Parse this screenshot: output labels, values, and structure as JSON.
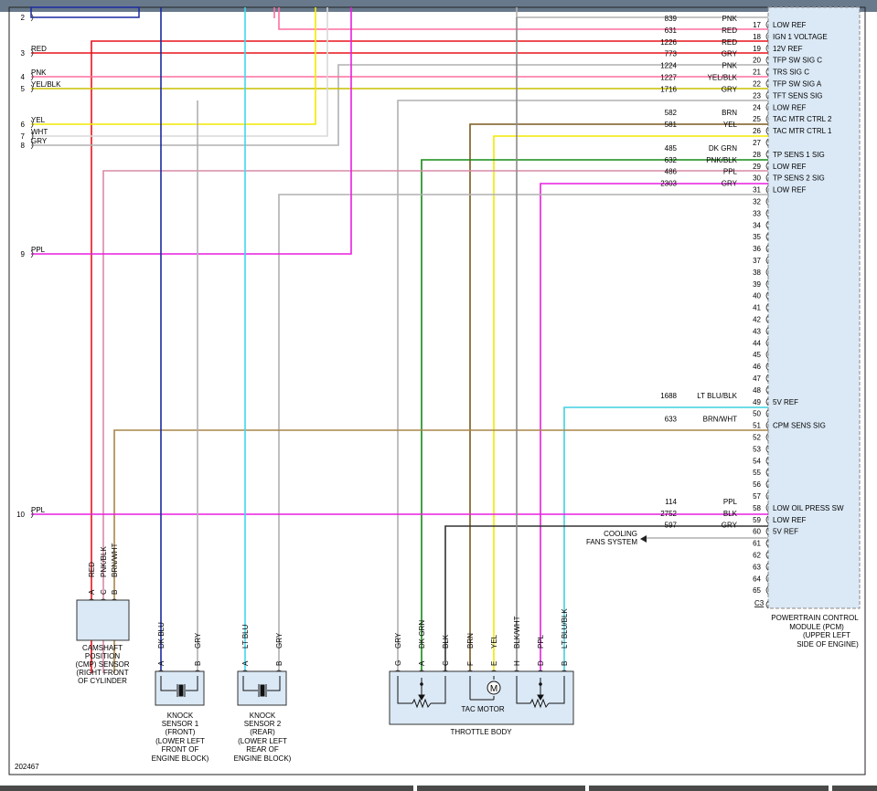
{
  "left_connector": [
    {
      "pin": "2",
      "color": ""
    },
    {
      "pin": "3",
      "color": "RED"
    },
    {
      "pin": "4",
      "color": "PNK"
    },
    {
      "pin": "5",
      "color": "YEL/BLK"
    },
    {
      "pin": "6",
      "color": "YEL"
    },
    {
      "pin": "7",
      "color": "WHT"
    },
    {
      "pin": "8",
      "color": "GRY"
    },
    {
      "pin": "9",
      "color": "PPL"
    },
    {
      "pin": "10",
      "color": "PPL"
    }
  ],
  "pcm_pins": [
    {
      "pin": "17",
      "circuit": "839",
      "color": "PNK",
      "func": "LOW REF"
    },
    {
      "pin": "18",
      "circuit": "631",
      "color": "RED",
      "func": "IGN 1 VOLTAGE"
    },
    {
      "pin": "19",
      "circuit": "1226",
      "color": "RED",
      "func": "12V REF"
    },
    {
      "pin": "20",
      "circuit": "773",
      "color": "GRY",
      "func": "TFP SW SIG C"
    },
    {
      "pin": "21",
      "circuit": "1224",
      "color": "PNK",
      "func": "TRS SIG C"
    },
    {
      "pin": "22",
      "circuit": "1227",
      "color": "YEL/BLK",
      "func": "TFP SW SIG A"
    },
    {
      "pin": "23",
      "circuit": "1716",
      "color": "GRY",
      "func": "TFT SENS SIG"
    },
    {
      "pin": "24",
      "circuit": "",
      "color": "",
      "func": "LOW REF"
    },
    {
      "pin": "25",
      "circuit": "582",
      "color": "BRN",
      "func": "TAC MTR CTRL 2"
    },
    {
      "pin": "26",
      "circuit": "581",
      "color": "YEL",
      "func": "TAC MTR CTRL 1"
    },
    {
      "pin": "27",
      "circuit": "",
      "color": "",
      "func": ""
    },
    {
      "pin": "28",
      "circuit": "485",
      "color": "DK GRN",
      "func": "TP SENS 1 SIG"
    },
    {
      "pin": "29",
      "circuit": "632",
      "color": "PNK/BLK",
      "func": "LOW REF"
    },
    {
      "pin": "30",
      "circuit": "486",
      "color": "PPL",
      "func": "TP SENS 2 SIG"
    },
    {
      "pin": "31",
      "circuit": "2303",
      "color": "GRY",
      "func": "LOW REF"
    },
    {
      "pin": "32",
      "circuit": "",
      "color": "",
      "func": ""
    },
    {
      "pin": "33",
      "circuit": "",
      "color": "",
      "func": ""
    },
    {
      "pin": "34",
      "circuit": "",
      "color": "",
      "func": ""
    },
    {
      "pin": "35",
      "circuit": "",
      "color": "",
      "func": ""
    },
    {
      "pin": "36",
      "circuit": "",
      "color": "",
      "func": ""
    },
    {
      "pin": "37",
      "circuit": "",
      "color": "",
      "func": ""
    },
    {
      "pin": "38",
      "circuit": "",
      "color": "",
      "func": ""
    },
    {
      "pin": "39",
      "circuit": "",
      "color": "",
      "func": ""
    },
    {
      "pin": "40",
      "circuit": "",
      "color": "",
      "func": ""
    },
    {
      "pin": "41",
      "circuit": "",
      "color": "",
      "func": ""
    },
    {
      "pin": "42",
      "circuit": "",
      "color": "",
      "func": ""
    },
    {
      "pin": "43",
      "circuit": "",
      "color": "",
      "func": ""
    },
    {
      "pin": "44",
      "circuit": "",
      "color": "",
      "func": ""
    },
    {
      "pin": "45",
      "circuit": "",
      "color": "",
      "func": ""
    },
    {
      "pin": "46",
      "circuit": "",
      "color": "",
      "func": ""
    },
    {
      "pin": "47",
      "circuit": "",
      "color": "",
      "func": ""
    },
    {
      "pin": "48",
      "circuit": "",
      "color": "",
      "func": ""
    },
    {
      "pin": "49",
      "circuit": "1688",
      "color": "LT BLU/BLK",
      "func": "5V REF"
    },
    {
      "pin": "50",
      "circuit": "",
      "color": "",
      "func": ""
    },
    {
      "pin": "51",
      "circuit": "633",
      "color": "BRN/WHT",
      "func": "CPM SENS SIG"
    },
    {
      "pin": "52",
      "circuit": "",
      "color": "",
      "func": ""
    },
    {
      "pin": "53",
      "circuit": "",
      "color": "",
      "func": ""
    },
    {
      "pin": "54",
      "circuit": "",
      "color": "",
      "func": ""
    },
    {
      "pin": "55",
      "circuit": "",
      "color": "",
      "func": ""
    },
    {
      "pin": "56",
      "circuit": "",
      "color": "",
      "func": ""
    },
    {
      "pin": "57",
      "circuit": "",
      "color": "",
      "func": ""
    },
    {
      "pin": "58",
      "circuit": "114",
      "color": "PPL",
      "func": "LOW OIL PRESS SW"
    },
    {
      "pin": "59",
      "circuit": "2752",
      "color": "BLK",
      "func": "LOW REF"
    },
    {
      "pin": "60",
      "circuit": "597",
      "color": "GRY",
      "func": "5V REF"
    },
    {
      "pin": "61",
      "circuit": "",
      "color": "",
      "func": ""
    },
    {
      "pin": "62",
      "circuit": "",
      "color": "",
      "func": ""
    },
    {
      "pin": "63",
      "circuit": "",
      "color": "",
      "func": ""
    },
    {
      "pin": "64",
      "circuit": "",
      "color": "",
      "func": ""
    },
    {
      "pin": "65",
      "circuit": "",
      "color": "",
      "func": ""
    }
  ],
  "connector_id": "C3",
  "pcm_label": [
    "POWERTRAIN CONTROL",
    "MODULE (PCM)",
    "(UPPER LEFT",
    "SIDE OF ENGINE)"
  ],
  "cooling_label": [
    "COOLING",
    "FANS SYSTEM"
  ],
  "cmp": {
    "wires": [
      {
        "pin": "A",
        "color": "RED"
      },
      {
        "pin": "C",
        "color": "PNK/BLK"
      },
      {
        "pin": "B",
        "color": "BRN/WHT"
      }
    ],
    "label": [
      "CAMSHAFT",
      "POSITION",
      "(CMP) SENSOR",
      "(RIGHT FRONT",
      "OF CYLINDER"
    ]
  },
  "ks1": {
    "wires": [
      {
        "pin": "A",
        "color": "DK BLU"
      },
      {
        "pin": "B",
        "color": "GRY"
      }
    ],
    "label": [
      "KNOCK",
      "SENSOR 1",
      "(FRONT)",
      "(LOWER LEFT",
      "FRONT OF",
      "ENGINE BLOCK)"
    ]
  },
  "ks2": {
    "wires": [
      {
        "pin": "A",
        "color": "LT BLU"
      },
      {
        "pin": "B",
        "color": "GRY"
      }
    ],
    "label": [
      "KNOCK",
      "SENSOR 2",
      "(REAR)",
      "(LOWER LEFT",
      "REAR OF",
      "ENGINE BLOCK)"
    ]
  },
  "throttle": {
    "wires": [
      {
        "pin": "G",
        "color": "GRY"
      },
      {
        "pin": "A",
        "color": "DK GRN"
      },
      {
        "pin": "C",
        "color": "BLK"
      },
      {
        "pin": "F",
        "color": "BRN"
      },
      {
        "pin": "E",
        "color": "YEL"
      },
      {
        "pin": "H",
        "color": "BLK/WHT"
      },
      {
        "pin": "D",
        "color": "PPL"
      },
      {
        "pin": "B",
        "color": "LT BLU/BLK"
      }
    ],
    "motor_symbol": "M",
    "motor_label": "TAC MOTOR",
    "label": "THROTTLE BODY"
  },
  "diagram_id": "202467",
  "wire_colors": {
    "RED": "#e8141c",
    "PNK": "#ff6f9f",
    "GRY": "#b0b0b0",
    "YEL": "#f2ea00",
    "YEL/BLK": "#c8bf00",
    "WHT": "#d8d8d8",
    "PPL": "#e81ee0",
    "DK BLU": "#1a2aa0",
    "LT BLU": "#3fd8ec",
    "DK GRN": "#158a15",
    "BRN": "#7a5a1e",
    "BLK": "#333333",
    "BLK/WHT": "#8a8a8a",
    "PNK/BLK": "#d88aa8",
    "BRN/WHT": "#a8864a",
    "LT BLU/BLK": "#3fd0e0"
  },
  "module_fill": "#dbe9f6"
}
